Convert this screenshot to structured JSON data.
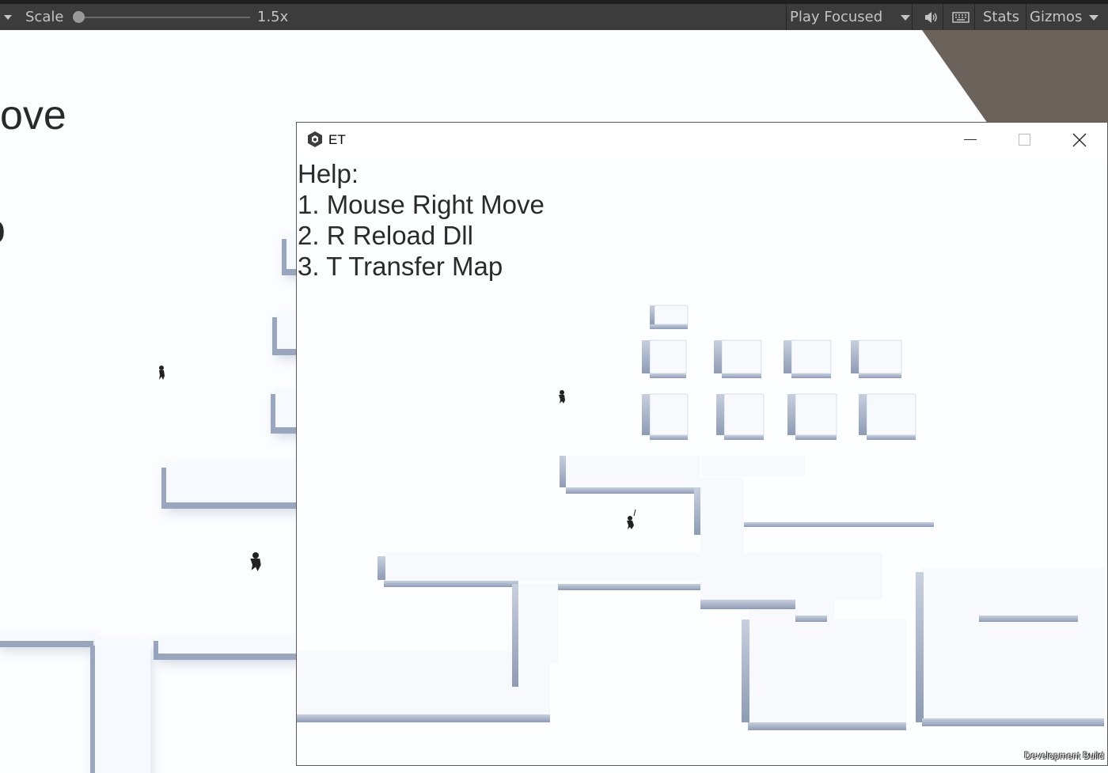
{
  "toolbar": {
    "scale_label": "Scale",
    "scale_value": "1.5x",
    "play_mode": "Play Focused",
    "stats_label": "Stats",
    "gizmos_label": "Gizmos"
  },
  "background": {
    "partial_text_top": "ove",
    "partial_text_mid": "o"
  },
  "window": {
    "title": "ET",
    "help_lines": [
      "Help:",
      "1. Mouse Right Move",
      "2. R Reload Dll",
      "3. T Transfer Map"
    ],
    "watermark": "Development Build"
  },
  "colors": {
    "toolbar_bg": "#3c3c3c",
    "toolbar_text": "#c4c4c4",
    "scene_bg": "#fcfdff",
    "block_shadow": "#9aa6bd",
    "wall_brown": "#6b625b"
  }
}
